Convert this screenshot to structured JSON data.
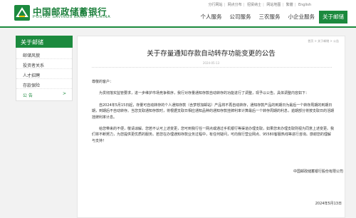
{
  "brand": {
    "name_cn": "中国邮政储蓄银行",
    "name_en": "POSTAL SAVINGS BANK OF CHINA",
    "color": "#1c8a3e"
  },
  "top_links": [
    "分行网站",
    "网点分布",
    "招贤纳士",
    "网站地图",
    "繁體",
    "English"
  ],
  "nav": [
    {
      "label": "个人服务",
      "active": false
    },
    {
      "label": "公司服务",
      "active": false
    },
    {
      "label": "三农服务",
      "active": false
    },
    {
      "label": "小企业服务",
      "active": false
    },
    {
      "label": "关于邮储",
      "active": true
    }
  ],
  "sidebar": {
    "title": "关于邮储",
    "items": [
      {
        "label": "邮储风貌"
      },
      {
        "label": "投资者关系"
      },
      {
        "label": "人才招聘"
      },
      {
        "label": "存款保险"
      },
      {
        "label": "公  告",
        "chevron": ">"
      }
    ]
  },
  "breadcrumb": "首页 > 关于邮储 > 公告",
  "article": {
    "title": "关于存量通知存款自动转存功能变更的公告",
    "date": "2024-05-13",
    "greeting": "尊敬的客户：",
    "paragraphs": [
      "为贯彻落实监管要求，进一步维护市场竞争秩序，我行对存量通知存款自动转存的功能进行了调整，现予以公告。具体调整内容如下：",
      "自2024年5月15日起，存量可自动转存的个人通知存款（含梦想加邮站）产品将不再自动转存，通知存款产品的到期日为最后一个转存周期的到期日期，到期后不自动转存。当您支取通知存款时，将根据支取日相应通知品种的通知存款挂牌利率计算最后一个转存周期的利息，逾期部分将按支取日的活期挂牌利率计息。",
      "给您带来的不便，敬请谅解。您若不认可上述变更，您可到我行任一网点或通过手机银行等渠道办理支取，如果您未办理支取则视为同意上述变更。我们将不断努力，为您提供更优质的服务。若您在办理通知存款业务过程中，有任何疑问，可向我行营业网点、95580客服热线等进行咨询。感谢您的理解与支持！"
    ],
    "signature": "中国邮政储蓄银行股份有限公司",
    "sign_date": "2024年5月13日"
  }
}
